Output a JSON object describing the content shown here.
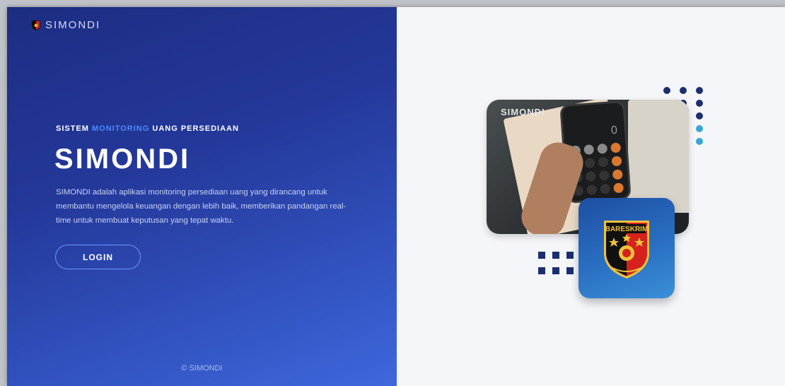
{
  "brand": {
    "name": "SIMONDI",
    "logo_icon": "police-shield-logo-icon"
  },
  "hero": {
    "tagline_part1": "SISTEM ",
    "tagline_accent": "MONITORING",
    "tagline_part2": " UANG PERSEDIAAN",
    "title": "SIMONDI",
    "description": "SIMONDI adalah aplikasi monitoring persediaan uang yang dirancang untuk membantu mengelola keuangan dengan lebih baik, memberikan pandangan real-time untuk membuat keputusan yang tepat waktu."
  },
  "login_button": {
    "label": "LOGIN"
  },
  "footer": {
    "copyright": "© SIMONDI"
  },
  "illustration": {
    "photo_label": "SIMONDI",
    "phone_display": "0",
    "emblem_text": "BARESKRIM"
  },
  "colors": {
    "left_gradient_start": "#1c2d82",
    "left_gradient_end": "#3f68dc",
    "accent": "#4b8cff",
    "right_bg": "#f5f6f9"
  }
}
